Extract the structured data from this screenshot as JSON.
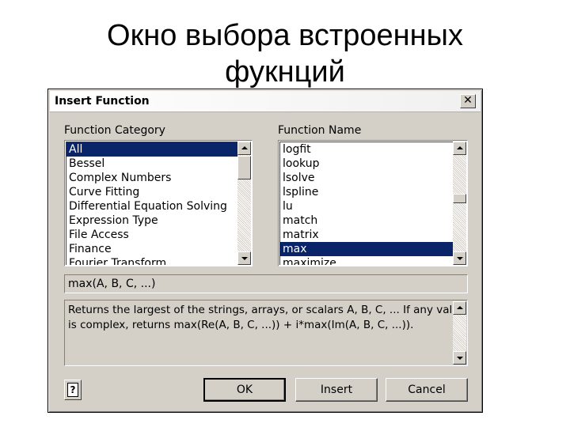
{
  "slide": {
    "title_line1": "Окно выбора встроенных",
    "title_line2": "фукнций"
  },
  "dialog": {
    "title": "Insert Function",
    "close_glyph": "✕",
    "category_label": "Function Category",
    "category_items": [
      "All",
      "Bessel",
      "Complex Numbers",
      "Curve Fitting",
      "Differential Equation Solving",
      "Expression Type",
      "File Access",
      "Finance",
      "Fourier Transform"
    ],
    "category_selected_index": 0,
    "name_label": "Function Name",
    "name_items": [
      "logfit",
      "lookup",
      "lsolve",
      "lspline",
      "lu",
      "match",
      "matrix",
      "max",
      "maximize"
    ],
    "name_selected_index": 7,
    "syntax": "max(A, B, C, ...)",
    "description": "Returns the largest of the strings, arrays, or scalars A, B, C, ... If any value\nis complex, returns max(Re(A, B, C, ...)) + i*max(Im(A, B, C, ...)).",
    "buttons": {
      "help": "?",
      "ok": "OK",
      "insert": "Insert",
      "cancel": "Cancel"
    }
  }
}
